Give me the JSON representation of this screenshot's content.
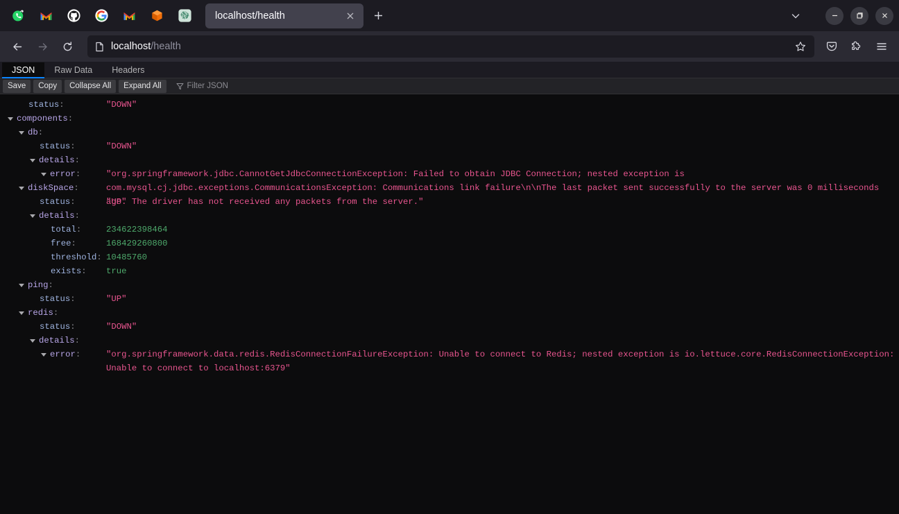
{
  "browser": {
    "pinned_tabs": [
      {
        "name": "whatsapp",
        "icon": "whatsapp-icon"
      },
      {
        "name": "gmail",
        "icon": "gmail-icon"
      },
      {
        "name": "github",
        "icon": "github-icon"
      },
      {
        "name": "google",
        "icon": "google-icon"
      },
      {
        "name": "gmail2",
        "icon": "gmail-icon"
      },
      {
        "name": "box3d",
        "icon": "orange-cube-icon"
      },
      {
        "name": "chatgpt",
        "icon": "chatgpt-icon"
      }
    ],
    "active_tab": {
      "title": "localhost/health"
    },
    "new_tab_label": "+",
    "window_controls": {
      "minimize": "—",
      "maximize": "❐",
      "close": "✕"
    },
    "url": {
      "host": "localhost",
      "path": "/health",
      "full": "localhost/health"
    },
    "nav": {
      "back": "←",
      "forward": "→",
      "reload": "⟳"
    },
    "accent": "#0a84ff"
  },
  "json_viewer": {
    "tabs": [
      {
        "label": "JSON",
        "active": true
      },
      {
        "label": "Raw Data",
        "active": false
      },
      {
        "label": "Headers",
        "active": false
      }
    ],
    "toolbar": {
      "save": "Save",
      "copy": "Copy",
      "collapse_all": "Collapse All",
      "expand_all": "Expand All",
      "filter_placeholder": "Filter JSON"
    },
    "colors": {
      "background": "#0c0c0d",
      "key": "#9fb4e0",
      "object_key": "#b8a6e8",
      "string": "#e9558f",
      "number": "#4ea96b"
    },
    "rows": [
      {
        "indent": 1,
        "twisty": false,
        "key": "status",
        "key_type": "plain",
        "value": "\"DOWN\"",
        "value_type": "string"
      },
      {
        "indent": 0,
        "twisty": true,
        "key": "components",
        "key_type": "object",
        "value": "",
        "value_type": "none"
      },
      {
        "indent": 1,
        "twisty": true,
        "key": "db",
        "key_type": "object",
        "value": "",
        "value_type": "none"
      },
      {
        "indent": 2,
        "twisty": false,
        "key": "status",
        "key_type": "plain",
        "value": "\"DOWN\"",
        "value_type": "string"
      },
      {
        "indent": 2,
        "twisty": true,
        "key": "details",
        "key_type": "object",
        "value": "",
        "value_type": "none"
      },
      {
        "indent": 3,
        "twisty": true,
        "key": "error",
        "key_type": "object",
        "value": "\"org.springframework.jdbc.CannotGetJdbcConnectionException: Failed to obtain JDBC Connection; nested exception is com.mysql.cj.jdbc.exceptions.CommunicationsException: Communications link failure\\n\\nThe last packet sent successfully to the server was 0 milliseconds ago. The driver has not received any packets from the server.\"",
        "value_type": "string"
      },
      {
        "indent": 1,
        "twisty": true,
        "key": "diskSpace",
        "key_type": "object",
        "value": "",
        "value_type": "none"
      },
      {
        "indent": 2,
        "twisty": false,
        "key": "status",
        "key_type": "plain",
        "value": "\"UP\"",
        "value_type": "string"
      },
      {
        "indent": 2,
        "twisty": true,
        "key": "details",
        "key_type": "object",
        "value": "",
        "value_type": "none"
      },
      {
        "indent": 3,
        "twisty": false,
        "key": "total",
        "key_type": "plain",
        "value": "234622398464",
        "value_type": "number"
      },
      {
        "indent": 3,
        "twisty": false,
        "key": "free",
        "key_type": "plain",
        "value": "168429260800",
        "value_type": "number"
      },
      {
        "indent": 3,
        "twisty": false,
        "key": "threshold",
        "key_type": "plain",
        "value": "10485760",
        "value_type": "number"
      },
      {
        "indent": 3,
        "twisty": false,
        "key": "exists",
        "key_type": "plain",
        "value": "true",
        "value_type": "boolean"
      },
      {
        "indent": 1,
        "twisty": true,
        "key": "ping",
        "key_type": "object",
        "value": "",
        "value_type": "none"
      },
      {
        "indent": 2,
        "twisty": false,
        "key": "status",
        "key_type": "plain",
        "value": "\"UP\"",
        "value_type": "string"
      },
      {
        "indent": 1,
        "twisty": true,
        "key": "redis",
        "key_type": "object",
        "value": "",
        "value_type": "none"
      },
      {
        "indent": 2,
        "twisty": false,
        "key": "status",
        "key_type": "plain",
        "value": "\"DOWN\"",
        "value_type": "string"
      },
      {
        "indent": 2,
        "twisty": true,
        "key": "details",
        "key_type": "object",
        "value": "",
        "value_type": "none"
      },
      {
        "indent": 3,
        "twisty": true,
        "key": "error",
        "key_type": "object",
        "value": "\"org.springframework.data.redis.RedisConnectionFailureException: Unable to connect to Redis; nested exception is io.lettuce.core.RedisConnectionException: Unable to connect to localhost:6379\"",
        "value_type": "string"
      }
    ]
  }
}
